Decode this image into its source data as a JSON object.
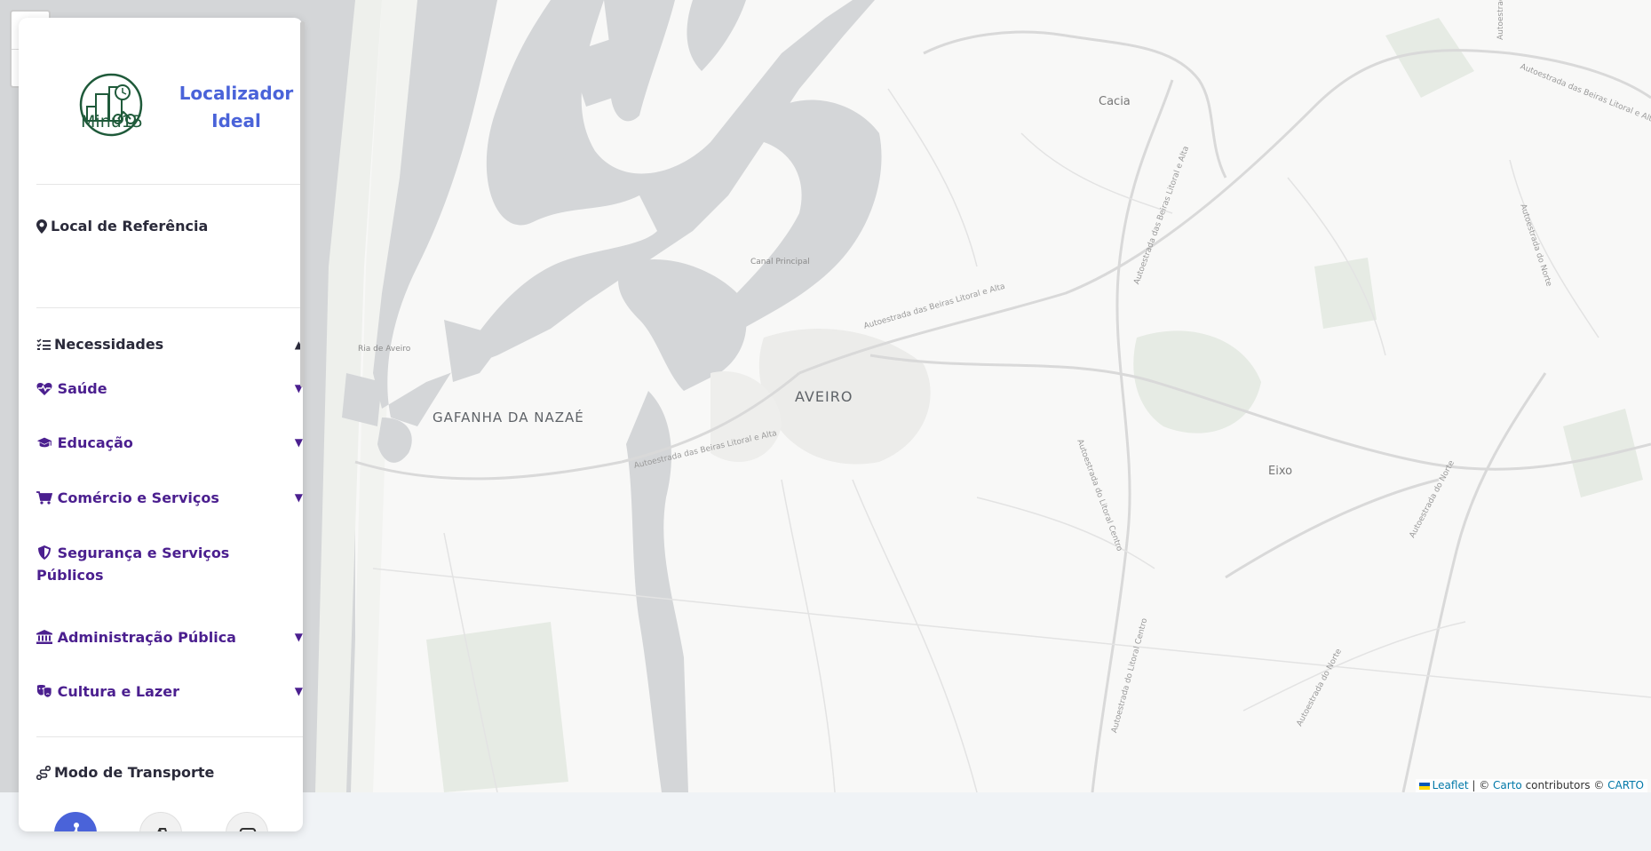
{
  "map": {
    "labels": {
      "aveiro": "AVEIRO",
      "gafanha": "GAFANHA DA NAZAÉ",
      "cacia": "Cacia",
      "eixo": "Eixo",
      "ria": "Ria de Aveiro",
      "canal": "Canal Principal",
      "road_a25_1": "Autoestrada das Beiras Litoral e Alta",
      "road_a25_2": "Autoestrada das Beiras Litoral e Alta",
      "road_a25_3": "Autoestrada das Beiras Litoral e Alta",
      "road_a25_4": "Autoestrada das Beiras Litoral e Alta",
      "road_a25_5": "Autoestrada das Beiras Litoral e Alta",
      "road_a1_1": "Autoestrada do Norte",
      "road_a1_2": "Autoestrada do Norte",
      "road_a1_3": "Autoestrada do Norte",
      "road_a17_1": "Autoestrada do Litoral Centro",
      "road_a17_2": "Autoestrada do Litoral Centro"
    },
    "zoom_in": "+",
    "zoom_out": "−",
    "attribution": {
      "leaflet": "Leaflet",
      "sep1": " | © ",
      "carto1": "Carto",
      "mid": " contributors © ",
      "carto2": "CARTO"
    }
  },
  "sidebar": {
    "logo_text": "Minu15",
    "app_title": "Localizador Ideal",
    "reference": {
      "icon": "map-marker-icon",
      "label": "Local de Referência"
    },
    "needs": {
      "icon": "list-check-icon",
      "label": "Necessidades",
      "arrow": "▲",
      "categories": [
        {
          "icon": "heart-pulse-icon",
          "label": "Saúde",
          "arrow": "▼"
        },
        {
          "icon": "graduation-cap-icon",
          "label": "Educação",
          "arrow": "▼"
        },
        {
          "icon": "shopping-cart-icon",
          "label": "Comércio e Serviços",
          "arrow": "▼"
        },
        {
          "icon": "shield-icon",
          "label": "Segurança e Serviços Públicos",
          "arrow": "▼"
        },
        {
          "icon": "landmark-icon",
          "label": "Administração Pública",
          "arrow": "▼"
        },
        {
          "icon": "theater-masks-icon",
          "label": "Cultura e Lazer",
          "arrow": "▼"
        }
      ]
    },
    "transport": {
      "icon": "route-icon",
      "label": "Modo de Transporte",
      "modes": [
        {
          "icon": "walking-icon",
          "active": true
        },
        {
          "icon": "bicycle-icon",
          "active": false
        },
        {
          "icon": "car-icon",
          "active": false
        }
      ]
    }
  },
  "colors": {
    "accent": "#4a63d9",
    "category_text": "#4b1f8f",
    "water": "#d4d6d8",
    "land": "#f8f8f7",
    "logo_green": "#1f5a3a"
  }
}
